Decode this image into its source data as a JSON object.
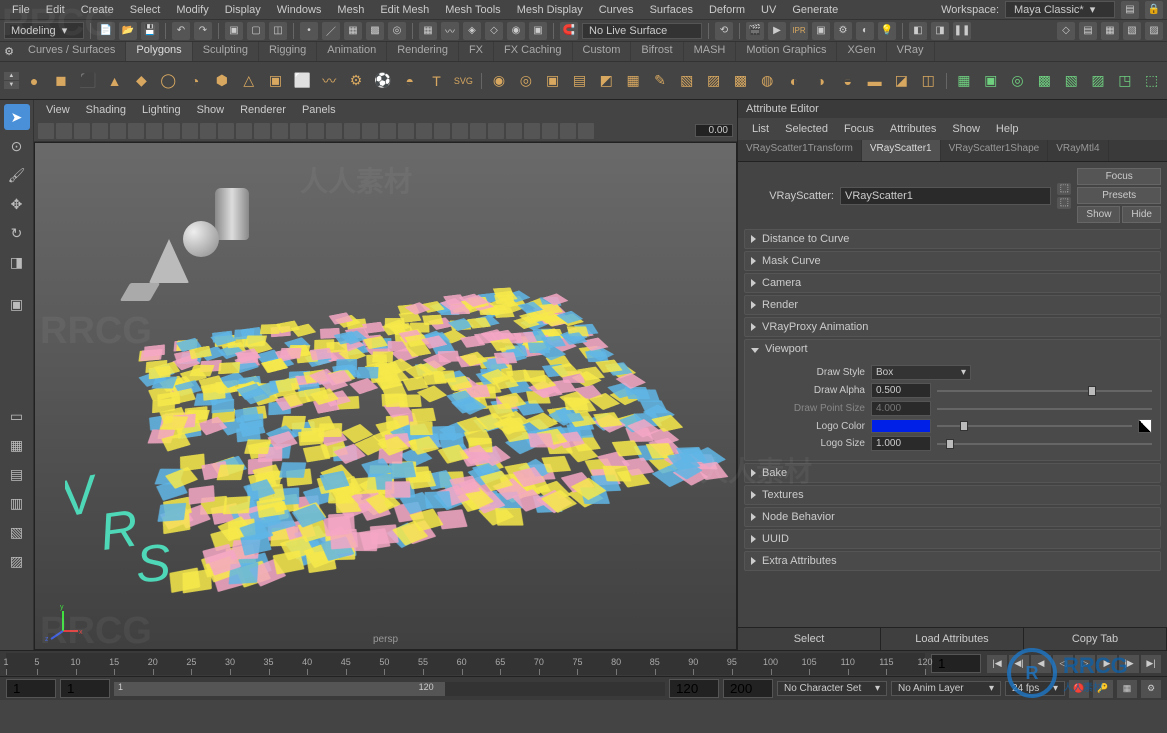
{
  "menus": [
    "File",
    "Edit",
    "Create",
    "Select",
    "Modify",
    "Display",
    "Windows",
    "Mesh",
    "Edit Mesh",
    "Mesh Tools",
    "Mesh Display",
    "Curves",
    "Surfaces",
    "Deform",
    "UV",
    "Generate"
  ],
  "workspace": {
    "label": "Workspace:",
    "value": "Maya Classic*"
  },
  "mode": "Modeling",
  "no_live_surface": "No Live Surface",
  "shelf_tabs": [
    "Curves / Surfaces",
    "Polygons",
    "Sculpting",
    "Rigging",
    "Animation",
    "Rendering",
    "FX",
    "FX Caching",
    "Custom",
    "Bifrost",
    "MASH",
    "Motion Graphics",
    "XGen",
    "VRay"
  ],
  "shelf_active": "Polygons",
  "panel_menus": [
    "View",
    "Shading",
    "Lighting",
    "Show",
    "Renderer",
    "Panels"
  ],
  "pt_value": "0.00",
  "viewport_camera": "persp",
  "attr": {
    "title": "Attribute Editor",
    "menus": [
      "List",
      "Selected",
      "Focus",
      "Attributes",
      "Show",
      "Help"
    ],
    "tabs": [
      "VRayScatter1Transform",
      "VRayScatter1",
      "VRayScatter1Shape",
      "VRayMtl4"
    ],
    "active_tab": "VRayScatter1",
    "name_label": "VRayScatter:",
    "name_value": "VRayScatter1",
    "side_buttons": {
      "focus": "Focus",
      "presets": "Presets",
      "show": "Show",
      "hide": "Hide"
    },
    "sections": {
      "distance_to_curve": "Distance to Curve",
      "mask_curve": "Mask Curve",
      "camera": "Camera",
      "render": "Render",
      "vrayproxy_anim": "VRayProxy Animation",
      "viewport": "Viewport",
      "bake": "Bake",
      "textures": "Textures",
      "node_behavior": "Node Behavior",
      "uuid": "UUID",
      "extra_attributes": "Extra Attributes"
    },
    "viewport_props": {
      "draw_style": {
        "label": "Draw Style",
        "value": "Box"
      },
      "draw_alpha": {
        "label": "Draw Alpha",
        "value": "0.500"
      },
      "draw_point_size": {
        "label": "Draw Point Size",
        "value": "4.000"
      },
      "logo_color": {
        "label": "Logo Color",
        "hex": "#0020e8"
      },
      "logo_size": {
        "label": "Logo Size",
        "value": "1.000"
      }
    },
    "bottom": {
      "select": "Select",
      "load": "Load Attributes",
      "copy": "Copy Tab"
    }
  },
  "timeline": {
    "ticks": [
      1,
      5,
      10,
      15,
      20,
      25,
      30,
      35,
      40,
      45,
      50,
      55,
      60,
      65,
      70,
      75,
      80,
      85,
      90,
      95,
      100,
      105,
      110,
      115,
      120
    ],
    "current": "1"
  },
  "range": {
    "start_all": "1",
    "start": "1",
    "end": "120",
    "end_all": "120",
    "mid1": "1",
    "mid2": "120",
    "mid3": "120",
    "mid4": "200",
    "char_set": "No Character Set",
    "anim_layer": "No Anim Layer",
    "fps": "24 fps"
  }
}
